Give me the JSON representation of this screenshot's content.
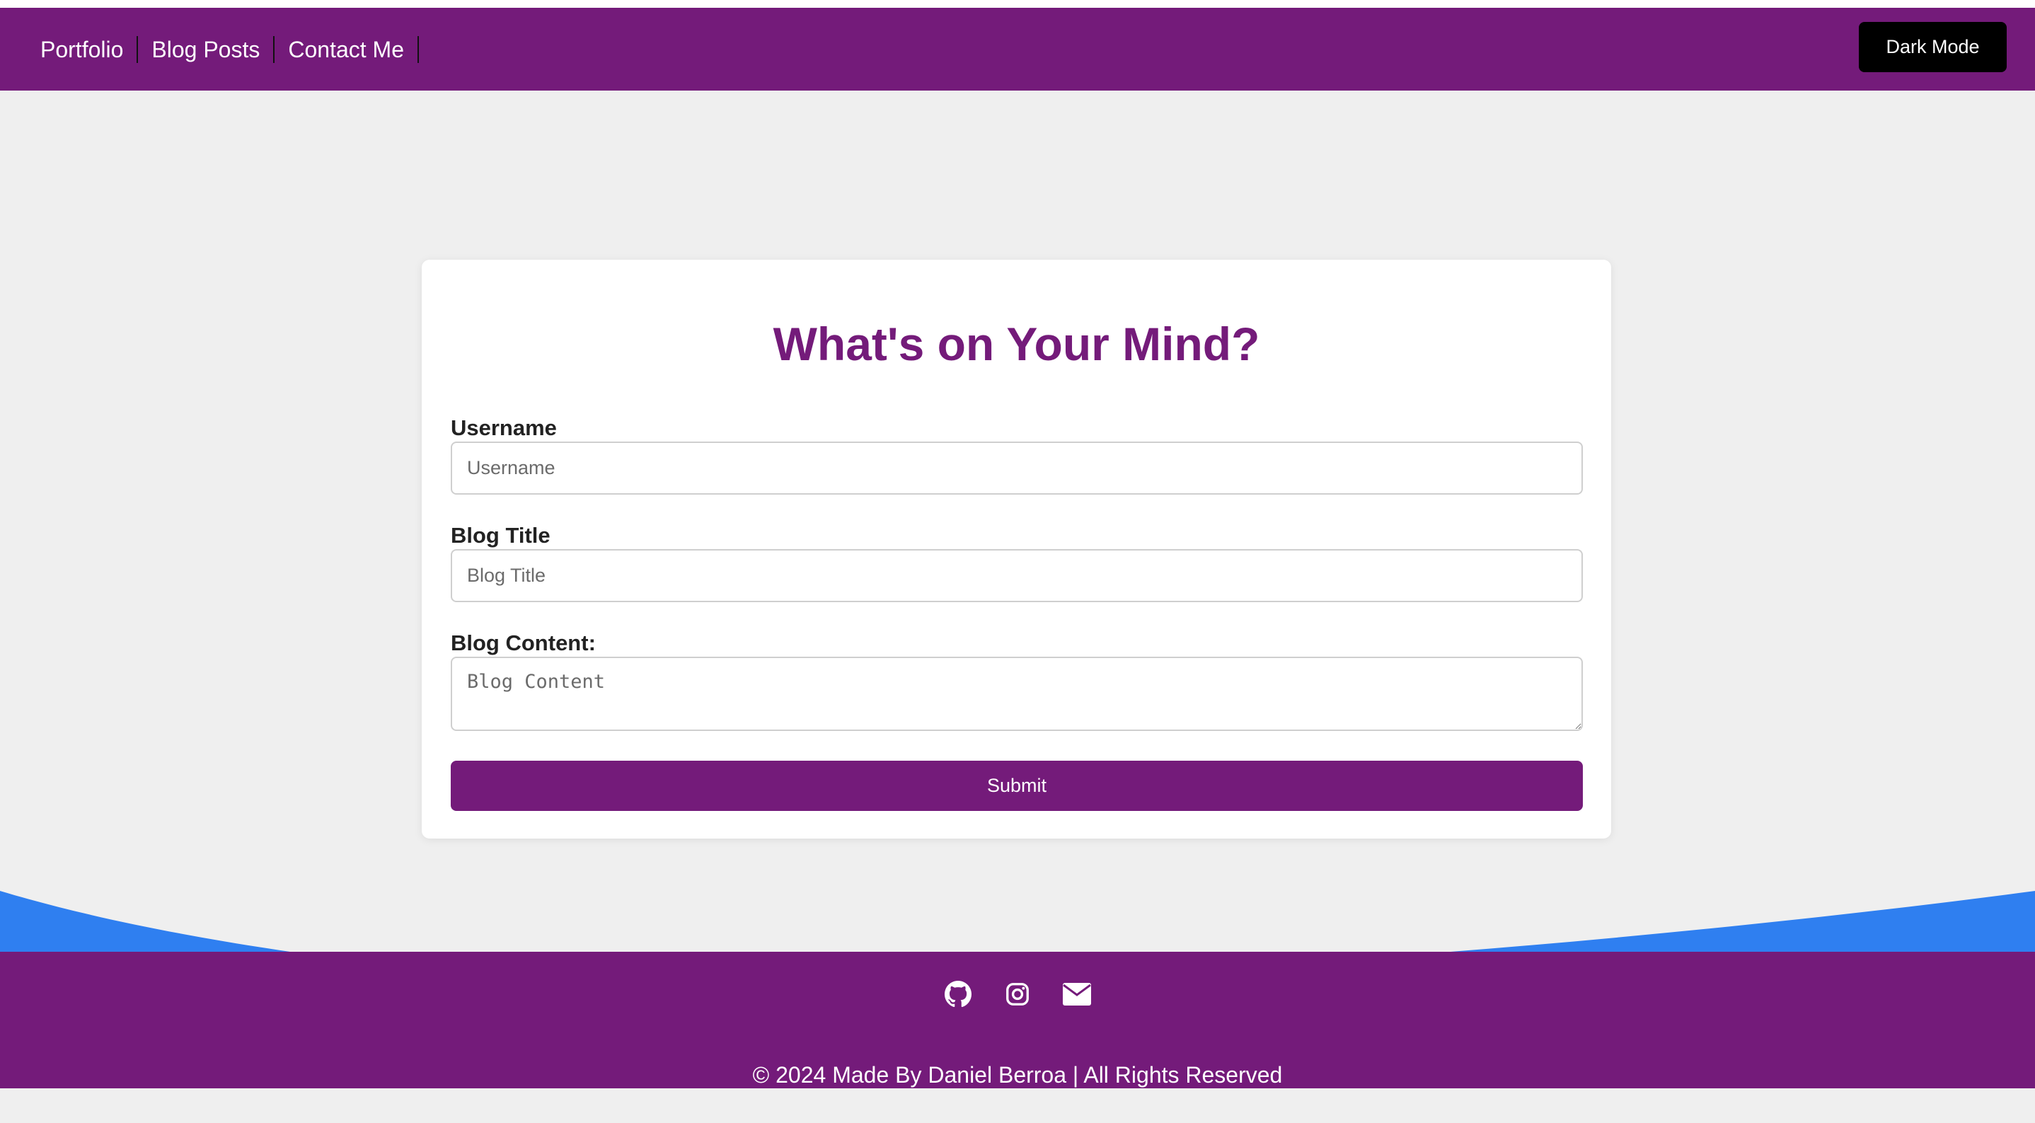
{
  "nav": {
    "links": [
      {
        "label": "Portfolio"
      },
      {
        "label": "Blog Posts"
      },
      {
        "label": "Contact Me"
      }
    ],
    "dark_mode_label": "Dark Mode"
  },
  "form": {
    "title": "What's on Your Mind?",
    "username_label": "Username",
    "username_placeholder": "Username",
    "username_value": "",
    "blog_title_label": "Blog Title",
    "blog_title_placeholder": "Blog Title",
    "blog_title_value": "",
    "blog_content_label": "Blog Content:",
    "blog_content_placeholder": "Blog Content",
    "blog_content_value": "",
    "submit_label": "Submit"
  },
  "footer": {
    "icons": [
      "github-icon",
      "instagram-icon",
      "envelope-icon"
    ],
    "copyright": "© 2024 Made By Daniel Berroa | All Rights Reserved"
  },
  "colors": {
    "brand_purple": "#741b7a",
    "wave_blue": "#2f7ff0",
    "page_bg": "#efefef"
  }
}
